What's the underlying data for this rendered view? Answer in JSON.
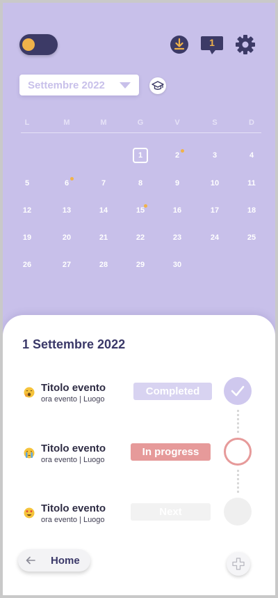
{
  "header": {
    "theme_toggle": "on",
    "icons": [
      "toggle-icon",
      "download-icon",
      "chat-icon",
      "gear-icon"
    ],
    "notification_count": "1"
  },
  "calendar": {
    "month_label": "Settembre 2022",
    "weekdays": [
      "L",
      "M",
      "M",
      "G",
      "V",
      "S",
      "D"
    ],
    "weeks": [
      [
        "",
        "",
        "",
        "1",
        "2",
        "3",
        "4"
      ],
      [
        "5",
        "6",
        "7",
        "8",
        "9",
        "10",
        "11"
      ],
      [
        "12",
        "13",
        "14",
        "15",
        "16",
        "17",
        "18"
      ],
      [
        "19",
        "20",
        "21",
        "22",
        "23",
        "24",
        "25"
      ],
      [
        "26",
        "27",
        "28",
        "29",
        "30",
        "",
        ""
      ]
    ],
    "today": "1",
    "days_with_events": [
      "2",
      "6",
      "15"
    ]
  },
  "agenda": {
    "date_title": "1 Settembre 2022",
    "events": [
      {
        "title": "Titolo evento",
        "subtitle": "ora evento | Luogo",
        "status": "Completed",
        "emoji": "yawning-face"
      },
      {
        "title": "Titolo evento",
        "subtitle": "ora evento | Luogo",
        "status": "In progress",
        "emoji": "crying-face"
      },
      {
        "title": "Titolo evento",
        "subtitle": "ora evento | Luogo",
        "status": "Next",
        "emoji": "heart-eyes-face"
      }
    ]
  },
  "footer": {
    "home_label": "Home"
  },
  "colors": {
    "background": "#c8c0ea",
    "dark": "#3c3a66",
    "accent_dot": "#f0b24a",
    "completed": "#d8d3f1",
    "in_progress": "#e69a9a",
    "next": "#f2f2f2"
  }
}
